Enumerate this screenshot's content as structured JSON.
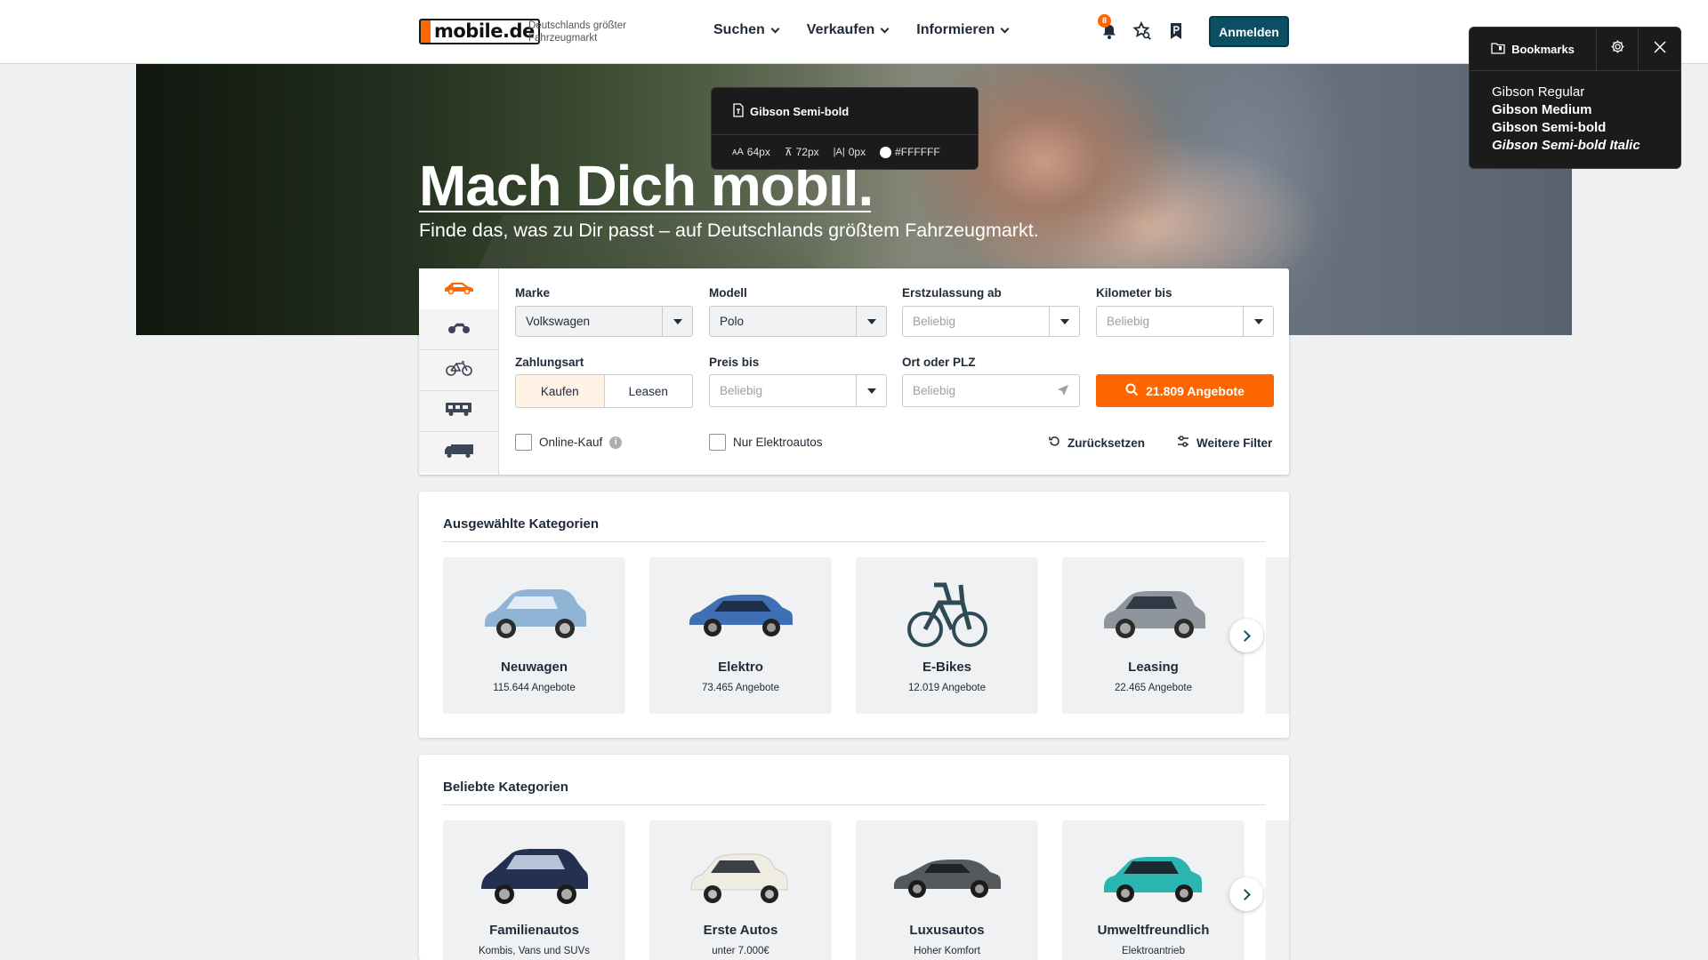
{
  "header": {
    "logo_text": "mobile.de",
    "tagline_line1": "Deutschlands größter",
    "tagline_line2": "Fahrzeugmarkt",
    "nav": [
      {
        "label": "Suchen"
      },
      {
        "label": "Verkaufen"
      },
      {
        "label": "Informieren"
      }
    ],
    "notification_count": "8",
    "login_label": "Anmelden"
  },
  "hero": {
    "title": "Mach Dich mobil.",
    "subtitle": "Finde das, was zu Dir passt – auf Deutschlands größtem Fahrzeugmarkt."
  },
  "font_tooltip": {
    "font_name": "Gibson Semi-bold",
    "font_size": "64px",
    "line_height": "72px",
    "letter_spacing": "0px",
    "color": "#FFFFFF"
  },
  "bookmarks_panel": {
    "tab_label": "Bookmarks",
    "items": [
      "Gibson Regular",
      "Gibson Medium",
      "Gibson Semi-bold",
      "Gibson Semi-bold Italic"
    ]
  },
  "search": {
    "marke_label": "Marke",
    "marke_value": "Volkswagen",
    "modell_label": "Modell",
    "modell_value": "Polo",
    "erstzulassung_label": "Erstzulassung ab",
    "erstzulassung_placeholder": "Beliebig",
    "kilometer_label": "Kilometer bis",
    "kilometer_placeholder": "Beliebig",
    "zahlungsart_label": "Zahlungsart",
    "zahlungsart_options": [
      "Kaufen",
      "Leasen"
    ],
    "preis_label": "Preis bis",
    "preis_placeholder": "Beliebig",
    "ort_label": "Ort oder PLZ",
    "ort_placeholder": "Beliebig",
    "submit_label": "21.809 Angebote",
    "online_kauf_label": "Online-Kauf",
    "elektro_label": "Nur Elektroautos",
    "reset_label": "Zurücksetzen",
    "more_filters_label": "Weitere Filter"
  },
  "selected_categories": {
    "title": "Ausgewählte Kategorien",
    "cards": [
      {
        "title": "Neuwagen",
        "subtitle": "115.644 Angebote",
        "color": "#8fb4d6"
      },
      {
        "title": "Elektro",
        "subtitle": "73.465 Angebote",
        "color": "#3f6fb4"
      },
      {
        "title": "E-Bikes",
        "subtitle": "12.019 Angebote",
        "color": "#2e4a56"
      },
      {
        "title": "Leasing",
        "subtitle": "22.465 Angebote",
        "color": "#8e959c"
      }
    ]
  },
  "popular_categories": {
    "title": "Beliebte Kategorien",
    "cards": [
      {
        "title": "Familienautos",
        "subtitle": "Kombis, Vans und SUVs",
        "color": "#23304f"
      },
      {
        "title": "Erste Autos",
        "subtitle": "unter 7.000€",
        "color": "#efece2"
      },
      {
        "title": "Luxusautos",
        "subtitle": "Hoher Komfort",
        "color": "#55585c"
      },
      {
        "title": "Umweltfreundlich",
        "subtitle": "Elektroantrieb",
        "color": "#2bb5b0"
      }
    ]
  }
}
